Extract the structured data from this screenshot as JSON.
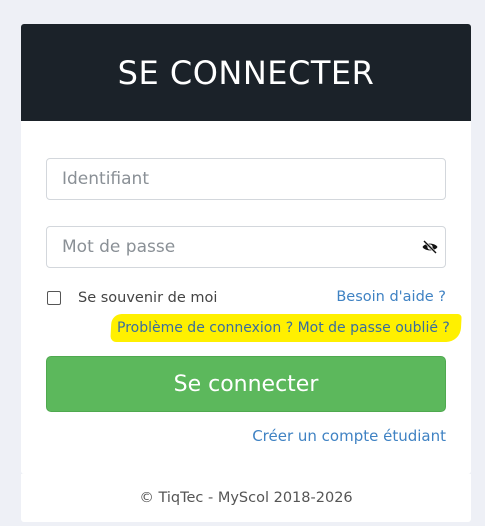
{
  "header": {
    "title": "SE CONNECTER"
  },
  "form": {
    "username_placeholder": "Identifiant",
    "username_value": "",
    "password_placeholder": "Mot de passe",
    "password_value": "",
    "remember_label": "Se souvenir de moi",
    "remember_checked": false,
    "help_link": "Besoin d'aide ?",
    "problem_link": "Problème de connexion ? Mot de passe oublié ?",
    "submit_label": "Se connecter",
    "create_account_link": "Créer un compte étudiant"
  },
  "icons": {
    "password_toggle": "eye-slash-icon"
  },
  "colors": {
    "header_bg": "#1b2229",
    "submit_bg": "#5cb85c",
    "link": "#3f82c3",
    "highlight": "#fff000"
  },
  "footer": {
    "text": "© TiqTec - MyScol 2018-2026"
  }
}
